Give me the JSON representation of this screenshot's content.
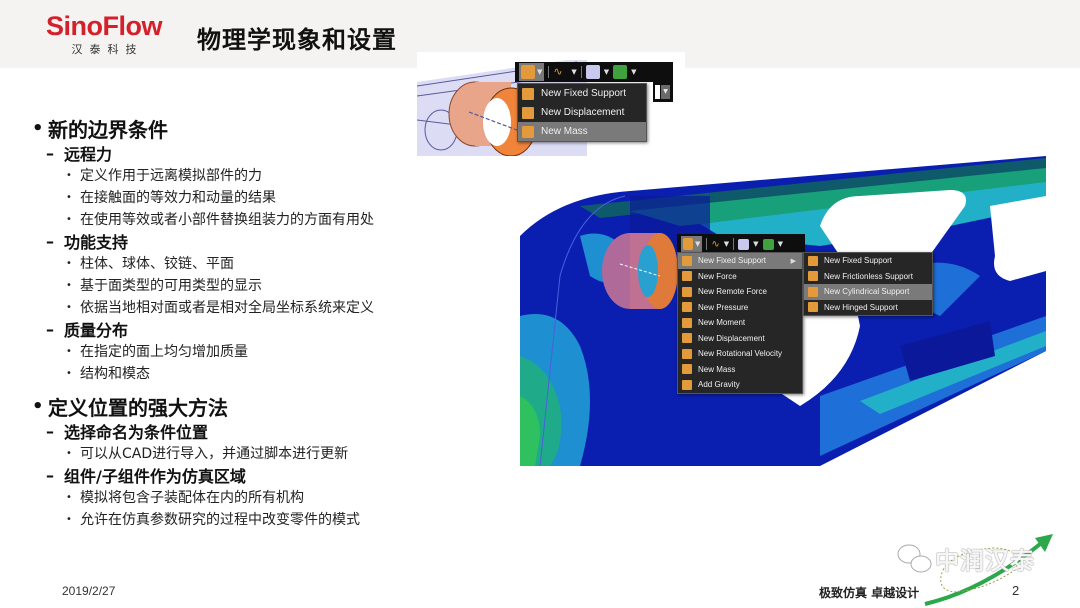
{
  "header": {
    "logo_main": "SinoFlow",
    "logo_sub": "汉泰科技",
    "title": "物理学现象和设置"
  },
  "outline": [
    {
      "heading": "新的边界条件",
      "sections": [
        {
          "title": "远程力",
          "items": [
            "定义作用于远离模拟部件的力",
            "在接触面的等效力和动量的结果",
            "在使用等效或者小部件替换组装力的方面有用处"
          ]
        },
        {
          "title": "功能支持",
          "items": [
            "柱体、球体、铰链、平面",
            "基于面类型的可用类型的显示",
            "依据当地相对面或者是相对全局坐标系统来定义"
          ]
        },
        {
          "title": "质量分布",
          "items": [
            "在指定的面上均匀增加质量",
            "结构和模态"
          ]
        }
      ]
    },
    {
      "heading": "定义位置的强大方法",
      "sections": [
        {
          "title": "选择命名为条件位置",
          "items": [
            "可以从CAD进行导入，并通过脚本进行更新"
          ]
        },
        {
          "title": "组件/子组件作为仿真区域",
          "items": [
            "模拟将包含子装配体在内的所有机构",
            "允许在仿真参数研究的过程中改变零件的模式"
          ]
        }
      ]
    }
  ],
  "small_menu": {
    "toolbar_icons": [
      "support-icon",
      "load-icon",
      "surface-icon",
      "body-icon"
    ],
    "items": [
      {
        "label": "New Fixed Support",
        "icon": "fixed-support-icon",
        "active": false
      },
      {
        "label": "New Displacement",
        "icon": "displacement-icon",
        "active": false
      },
      {
        "label": "New Mass",
        "icon": "mass-icon",
        "active": true
      }
    ]
  },
  "main_menu": {
    "toolbar_icons": [
      "support-icon",
      "load-icon",
      "surface-icon",
      "body-icon"
    ],
    "items": [
      {
        "label": "New Fixed Support",
        "icon": "fixed-support-icon",
        "active": true,
        "has_submenu": true
      },
      {
        "label": "New Force",
        "icon": "force-icon",
        "active": false
      },
      {
        "label": "New Remote Force",
        "icon": "remote-force-icon",
        "active": false
      },
      {
        "label": "New Pressure",
        "icon": "pressure-icon",
        "active": false
      },
      {
        "label": "New Moment",
        "icon": "moment-icon",
        "active": false
      },
      {
        "label": "New Displacement",
        "icon": "displacement-icon",
        "active": false
      },
      {
        "label": "New Rotational Velocity",
        "icon": "rotational-velocity-icon",
        "active": false
      },
      {
        "label": "New Mass",
        "icon": "mass-icon",
        "active": false
      },
      {
        "label": "Add Gravity",
        "icon": "gravity-icon",
        "active": false
      }
    ],
    "submenu": [
      {
        "label": "New Fixed Support",
        "icon": "fixed-support-icon",
        "active": false
      },
      {
        "label": "New Frictionless Support",
        "icon": "frictionless-support-icon",
        "active": false
      },
      {
        "label": "New Cylindrical Support",
        "icon": "cylindrical-support-icon",
        "active": true
      },
      {
        "label": "New Hinged Support",
        "icon": "hinged-support-icon",
        "active": false
      }
    ]
  },
  "footer": {
    "date": "2019/2/27",
    "slogan": "极致仿真 卓越设计",
    "page_number": "2",
    "watermark": "中润汉泰"
  },
  "colors": {
    "brand_red": "#d3202a",
    "header_bg": "#f4f3f1",
    "menu_bg": "#262626",
    "menu_active": "#7a7a7a",
    "icon_orange": "#e39a3b"
  }
}
